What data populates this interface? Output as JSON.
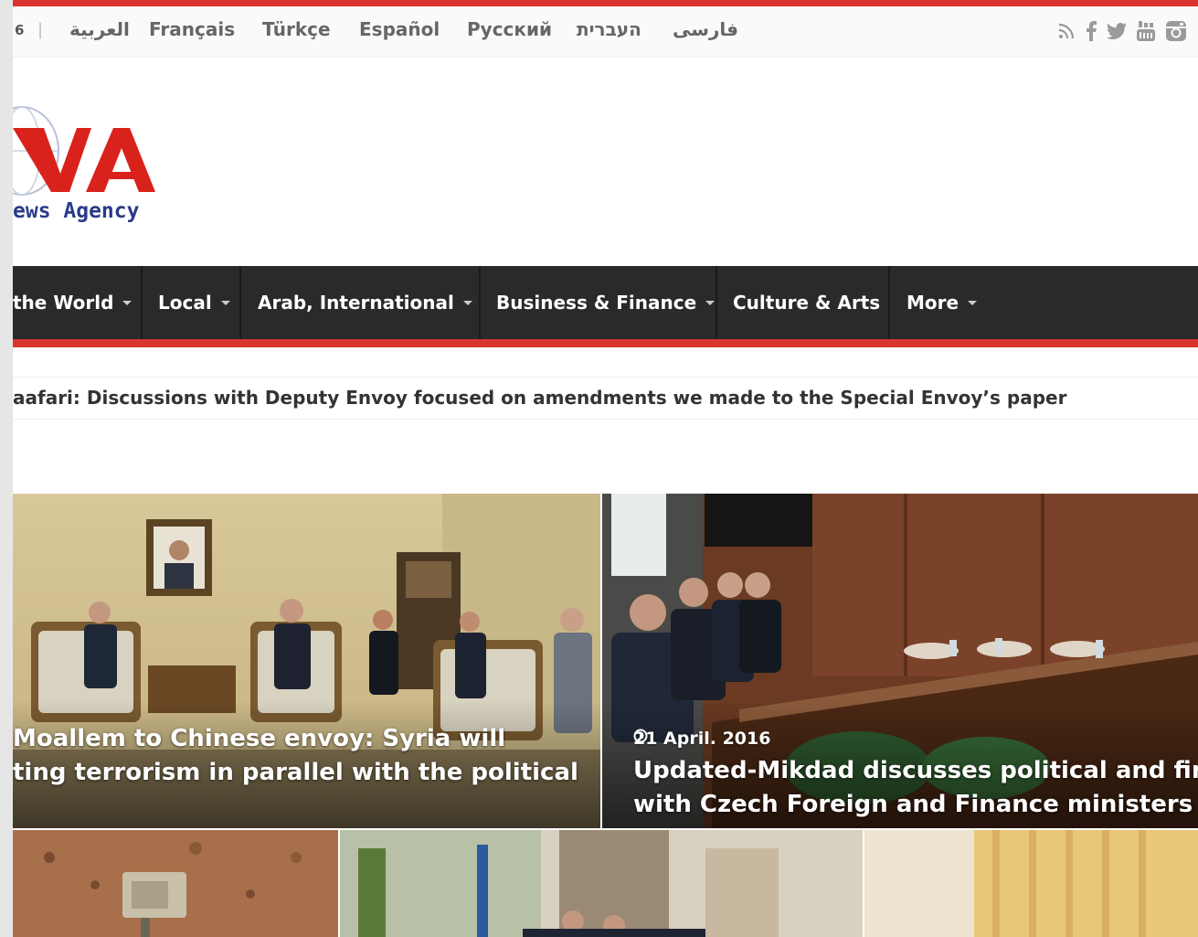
{
  "topbar": {
    "date_fragment": "6",
    "languages": [
      "العربية",
      "Français",
      "Türkçe",
      "Español",
      "Русский",
      "העברית",
      "فارسی"
    ],
    "social_icons": [
      "rss-icon",
      "facebook-icon",
      "twitter-icon",
      "youtube-icon",
      "instagram-icon"
    ],
    "accent_color": "#d9352e"
  },
  "logo": {
    "big_text": "VA",
    "sub_text": "ews Agency"
  },
  "nav": {
    "items": [
      {
        "label": "the World",
        "dropdown": true
      },
      {
        "label": "Local",
        "dropdown": true
      },
      {
        "label": "Arab, International",
        "dropdown": true
      },
      {
        "label": "Business & Finance",
        "dropdown": true
      },
      {
        "label": "Culture & Arts",
        "dropdown": false
      },
      {
        "label": "More",
        "dropdown": true
      }
    ]
  },
  "ticker": {
    "text": "aafari: Discussions with Deputy Envoy focused on amendments we made to the Special Envoy’s paper"
  },
  "featured": [
    {
      "line1": "Moallem to Chinese envoy: Syria will",
      "line2": "ting terrorism in parallel with the political",
      "date": ""
    },
    {
      "date": "21 April. 2016",
      "line1": "Updated-Mikdad discusses political and fina",
      "line2": "with Czech Foreign and Finance ministers"
    }
  ]
}
